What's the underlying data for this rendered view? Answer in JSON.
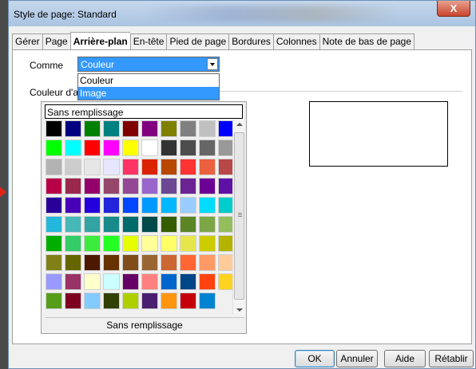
{
  "window": {
    "title": "Style de page: Standard",
    "close_label": "X"
  },
  "tabs": [
    {
      "label": "Gérer",
      "active": false
    },
    {
      "label": "Page",
      "active": false
    },
    {
      "label": "Arrière-plan",
      "active": true
    },
    {
      "label": "En-tête",
      "active": false
    },
    {
      "label": "Pied de page",
      "active": false
    },
    {
      "label": "Bordures",
      "active": false
    },
    {
      "label": "Colonnes",
      "active": false
    },
    {
      "label": "Note de bas de page",
      "active": false
    }
  ],
  "comme": {
    "label": "Comme",
    "selected": "Couleur",
    "options": [
      {
        "label": "Couleur",
        "highlighted": false
      },
      {
        "label": "Image",
        "highlighted": true
      }
    ]
  },
  "couleur": {
    "label": "Couleur d'a"
  },
  "palette": {
    "no_fill_field": "Sans remplissage",
    "footer": "Sans remplissage",
    "colors": [
      "#000000",
      "#000080",
      "#008000",
      "#008080",
      "#800000",
      "#800080",
      "#808000",
      "#808080",
      "#c0c0c0",
      "#0000ff",
      "#00ff00",
      "#00ffff",
      "#ff0000",
      "#ff00ff",
      "#ffff00",
      "#ffffff",
      "#333333",
      "#4d4d4d",
      "#666666",
      "#999999",
      "#b3b3b3",
      "#cccccc",
      "#e6e6e6",
      "#e6e6ff",
      "#ff3366",
      "#dc2300",
      "#b84700",
      "#ff3333",
      "#eb613d",
      "#b84747",
      "#b80047",
      "#99284c",
      "#94006b",
      "#94476b",
      "#944794",
      "#9966cc",
      "#6b4794",
      "#6b2394",
      "#6b0094",
      "#5e11a6",
      "#280099",
      "#4700b8",
      "#2300dc",
      "#2323dc",
      "#0047ff",
      "#0099ff",
      "#00b8ff",
      "#99ccff",
      "#00dcff",
      "#00cccc",
      "#23b8dc",
      "#47b8b8",
      "#33a3a3",
      "#198a8a",
      "#006b6b",
      "#004a4a",
      "#355e00",
      "#5c8526",
      "#7da647",
      "#94bd5e",
      "#00ae00",
      "#33cc66",
      "#3deb3d",
      "#23ff23",
      "#e6ff00",
      "#ffff99",
      "#ffff66",
      "#e6e64c",
      "#cccc00",
      "#b3b300",
      "#808019",
      "#666600",
      "#4c1900",
      "#663300",
      "#804c19",
      "#996633",
      "#cc6633",
      "#ff6633",
      "#ff9966",
      "#ffcc99",
      "#9999ff",
      "#993366",
      "#ffffcc",
      "#ccffff",
      "#660066",
      "#ff8080",
      "#0066cc",
      "#004586",
      "#ff420e",
      "#ffd320",
      "#579d1c",
      "#7e0021",
      "#83caff",
      "#314004",
      "#aecf00",
      "#4b1f6f",
      "#ff950e",
      "#c5000b",
      "#0084d1"
    ]
  },
  "buttons": {
    "ok": "OK",
    "annuler": "Annuler",
    "aide": "Aide",
    "retablir": "Rétablir"
  }
}
